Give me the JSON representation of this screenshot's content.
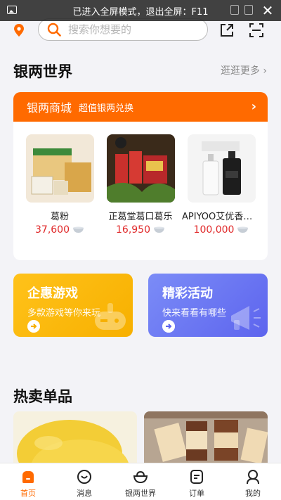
{
  "fullscreen_banner": {
    "text": "已进入全屏模式，退出全屏：F11"
  },
  "search": {
    "placeholder": "搜索你想要的"
  },
  "silver_world": {
    "title": "银两世界",
    "more": "逛逛更多 ›"
  },
  "mall": {
    "name": "银两商城",
    "subtitle": "超值银两兑换",
    "arrow": "›",
    "products": [
      {
        "title": "葛粉",
        "price": "37,600"
      },
      {
        "title": "正葛堂葛口葛乐",
        "price": "16,950"
      },
      {
        "title": "APIYOO艾优香体...",
        "price": "100,000"
      }
    ]
  },
  "promo_cards": [
    {
      "title": "企惠游戏",
      "desc": "多款游戏等你来玩",
      "color": "#f7b500"
    },
    {
      "title": "精彩活动",
      "desc": "快来看看有哪些",
      "color": "#6b73f3"
    }
  ],
  "hot": {
    "title": "热卖单品"
  },
  "tabbar": [
    {
      "label": "首页",
      "icon": "home-icon",
      "active": true
    },
    {
      "label": "消息",
      "icon": "message-icon"
    },
    {
      "label": "银两世界",
      "icon": "silver-bowl-icon"
    },
    {
      "label": "订单",
      "icon": "order-icon"
    },
    {
      "label": "我的",
      "icon": "profile-icon"
    }
  ],
  "colors": {
    "accent": "#ff6a00",
    "price": "#e0292a",
    "background": "#f3f3f7"
  }
}
